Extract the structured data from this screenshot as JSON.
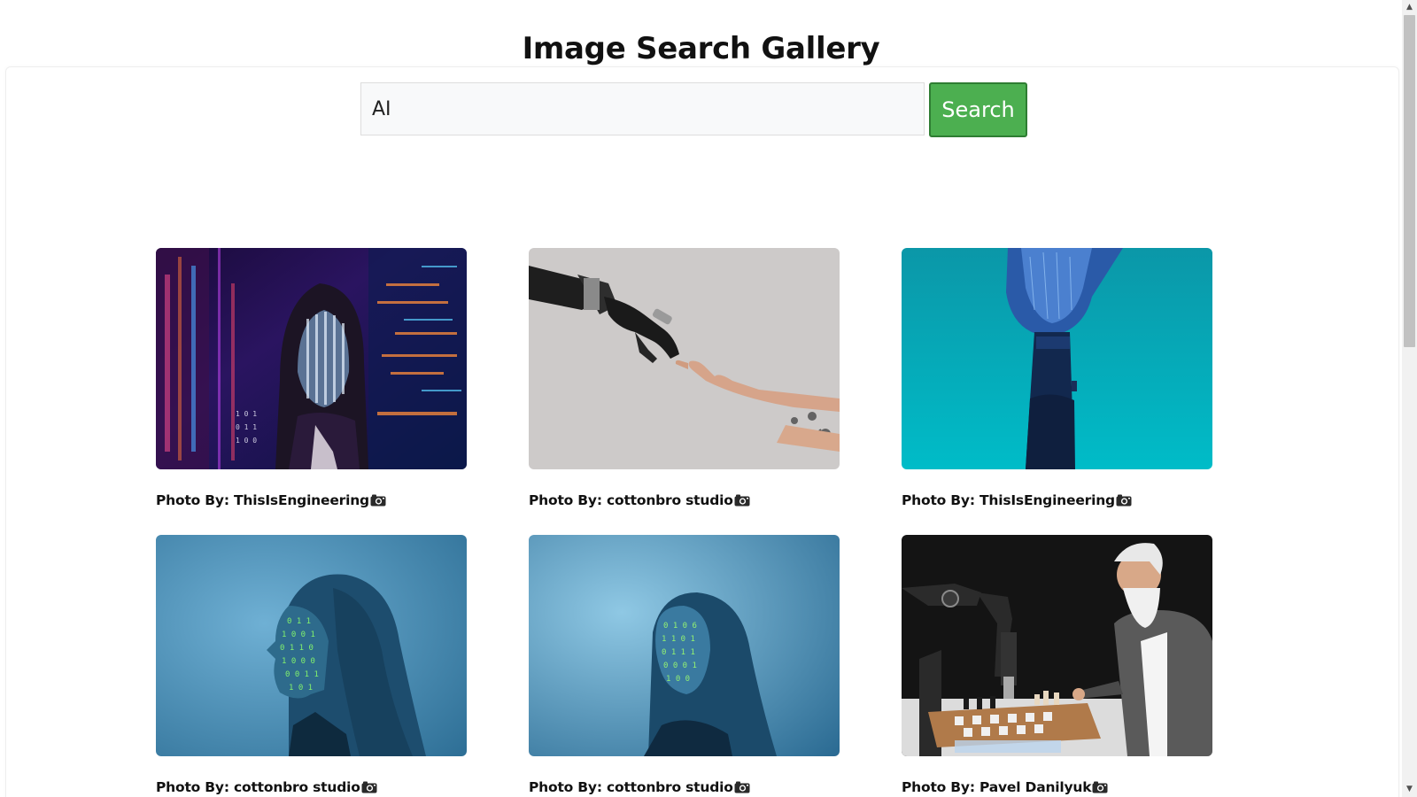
{
  "page": {
    "title": "Image Search Gallery"
  },
  "search": {
    "query": "AI",
    "button_label": "Search"
  },
  "gallery": {
    "items": [
      {
        "caption": "Photo By: ThisIsEngineering",
        "subject": "woman-with-code-projection"
      },
      {
        "caption": "Photo By: cottonbro studio",
        "subject": "robot-hand-touching-human-hand"
      },
      {
        "caption": "Photo By: ThisIsEngineering",
        "subject": "blue-robotic-hand-on-teal"
      },
      {
        "caption": "Photo By: cottonbro studio",
        "subject": "woman-profile-binary-projection"
      },
      {
        "caption": "Photo By: cottonbro studio",
        "subject": "woman-binary-projection-blue"
      },
      {
        "caption": "Photo By: Pavel Danilyuk",
        "subject": "man-playing-chess-with-robot-arm"
      }
    ],
    "icon": "camera-icon"
  },
  "colors": {
    "search_button": "#4caf50",
    "search_button_border": "#2e7d32"
  }
}
